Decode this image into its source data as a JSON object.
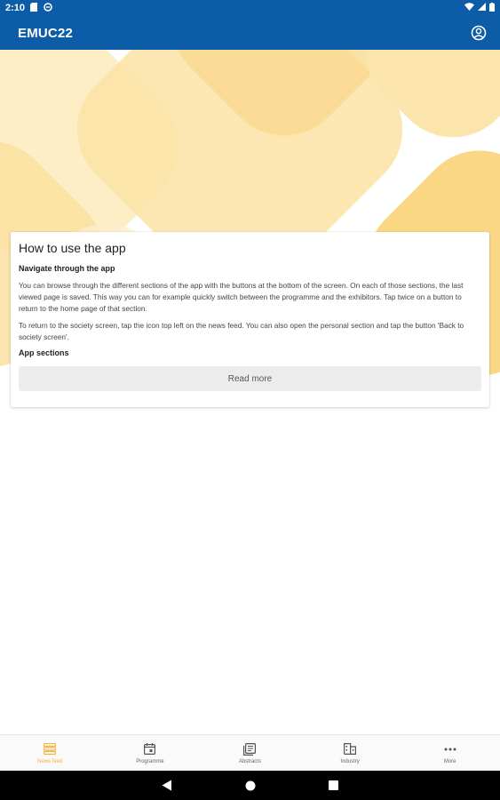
{
  "status_bar": {
    "time": "2:10",
    "icons": [
      "sd-card-icon",
      "data-saver-icon",
      "wifi-icon",
      "signal-icon",
      "battery-icon"
    ]
  },
  "app_bar": {
    "title": "EMUC22",
    "profile_icon": "account-circle-icon"
  },
  "colors": {
    "primary": "#0d5ca8",
    "accent": "#f2b23a",
    "decor_light": "#fbe7b2",
    "decor_mid": "#f8d98a"
  },
  "card": {
    "title": "How to use the app",
    "subtitle": "Navigate through the app",
    "paragraph1": "You can browse through the different sections of the app with the buttons at the bottom of the screen. On each of those sections, the last viewed page is saved. This way you can for example quickly switch between the programme and the exhibitors. Tap twice on a button to return to the home page of that section.",
    "paragraph2": "To return to the society screen, tap the icon top left on the news feed. You can also open the personal section and tap the button 'Back to society screen'.",
    "subtitle2": "App sections",
    "read_more": "Read more"
  },
  "bottom_nav": {
    "items": [
      {
        "label": "News feed",
        "icon": "news-feed-icon",
        "active": true
      },
      {
        "label": "Programme",
        "icon": "calendar-icon",
        "active": false
      },
      {
        "label": "Abstracts",
        "icon": "abstracts-icon",
        "active": false
      },
      {
        "label": "Industry",
        "icon": "building-icon",
        "active": false
      },
      {
        "label": "More",
        "icon": "more-dots-icon",
        "active": false
      }
    ]
  },
  "system_nav": {
    "buttons": [
      "back-icon",
      "home-icon",
      "recents-icon"
    ]
  }
}
